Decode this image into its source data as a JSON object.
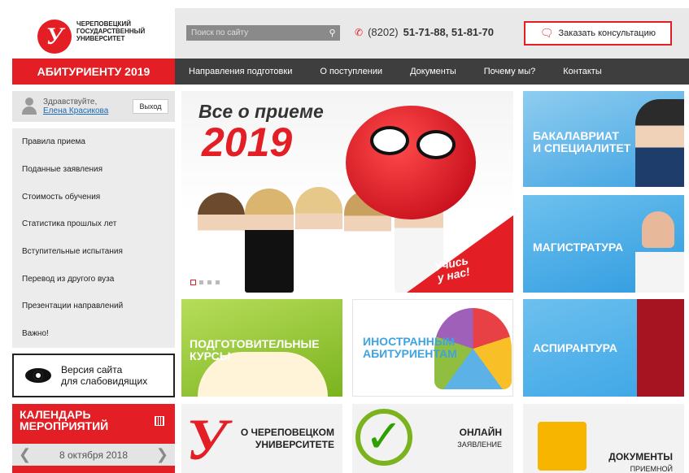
{
  "header": {
    "logo_text": "ЧЕРЕПОВЕЦКИЙ ГОСУДАРСТВЕННЫЙ УНИВЕРСИТЕТ",
    "search_placeholder": "Поиск по сайту",
    "phone_code": "(8202)",
    "phone_numbers": "51-71-88, 51-81-70",
    "consult_label": "Заказать консультацию"
  },
  "nav": {
    "applicant": "АБИТУРИЕНТУ 2019",
    "items": [
      "Направления подготовки",
      "О поступлении",
      "Документы",
      "Почему мы?",
      "Контакты"
    ]
  },
  "user": {
    "greeting": "Здравствуйте,",
    "name": "Елена Красикова",
    "logout": "Выход"
  },
  "sidebar": {
    "items": [
      "Правила приема",
      "Поданные заявления",
      "Стоимость обучения",
      "Статистика прошлых лет",
      "Вступительные испытания",
      "Перевод из другого вуза",
      "Презентации направлений",
      "Важно!"
    ]
  },
  "vision": {
    "line1": "Версия сайта",
    "line2": "для слабовидящих"
  },
  "calendar": {
    "title_line1": "КАЛЕНДАРЬ",
    "title_line2": "МЕРОПРИЯТИЙ",
    "date": "8 октября 2018"
  },
  "banner": {
    "title": "Все о приеме",
    "year": "2019",
    "slogan_line1": "Учись",
    "slogan_line2": "у нас!"
  },
  "tiles": {
    "bachelor_line1": "БАКАЛАВРИАТ",
    "bachelor_line2": "И СПЕЦИАЛИТЕТ",
    "master": "МАГИСТРАТУРА",
    "postgrad": "АСПИРАНТУРА",
    "courses_line1": "ПОДГОТОВИТЕЛЬНЫЕ",
    "courses_line2": "КУРСЫ",
    "foreign_line1": "ИНОСТРАННЫМ",
    "foreign_line2": "АБИТУРИЕНТАМ",
    "about_line1": "О ЧЕРЕПОВЕЦКОМ",
    "about_line2": "УНИВЕРСИТЕТЕ",
    "online_line1": "ОНЛАЙН",
    "online_line2": "ЗАЯВЛЕНИЕ",
    "docs_line1": "ДОКУМЕНТЫ",
    "docs_line2": "ПРИЕМНОЙ"
  },
  "colors": {
    "brand_red": "#e31e24",
    "nav_dark": "#3e3e3e",
    "tile_blue": "#3fa3e2",
    "tile_green": "#7bb31f"
  }
}
